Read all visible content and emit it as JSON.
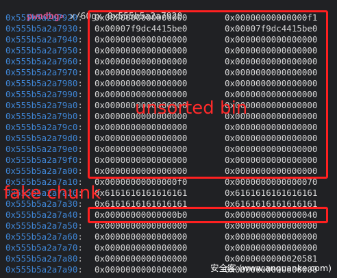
{
  "terminal": {
    "prompt": "pwndbg>",
    "command": " x/60gx 0x555b5a2a7920",
    "rows": [
      {
        "addr": "0x555b5a2a7920",
        "v1": "0x0000000000000000",
        "v2": "0x00000000000000f1"
      },
      {
        "addr": "0x555b5a2a7930",
        "v1": "0x00007f9dc4415be0",
        "v2": "0x00007f9dc4415be0"
      },
      {
        "addr": "0x555b5a2a7940",
        "v1": "0x0000000000000000",
        "v2": "0x0000000000000000"
      },
      {
        "addr": "0x555b5a2a7950",
        "v1": "0x0000000000000000",
        "v2": "0x0000000000000000"
      },
      {
        "addr": "0x555b5a2a7960",
        "v1": "0x0000000000000000",
        "v2": "0x0000000000000000"
      },
      {
        "addr": "0x555b5a2a7970",
        "v1": "0x0000000000000000",
        "v2": "0x0000000000000000"
      },
      {
        "addr": "0x555b5a2a7980",
        "v1": "0x0000000000000000",
        "v2": "0x0000000000000000"
      },
      {
        "addr": "0x555b5a2a7990",
        "v1": "0x0000000000000000",
        "v2": "0x0000000000000000"
      },
      {
        "addr": "0x555b5a2a79a0",
        "v1": "0x0000000000000000",
        "v2": "0x0000000000000000"
      },
      {
        "addr": "0x555b5a2a79b0",
        "v1": "0x0000000000000000",
        "v2": "0x0000000000000000"
      },
      {
        "addr": "0x555b5a2a79c0",
        "v1": "0x0000000000000000",
        "v2": "0x0000000000000000"
      },
      {
        "addr": "0x555b5a2a79d0",
        "v1": "0x0000000000000000",
        "v2": "0x0000000000000000"
      },
      {
        "addr": "0x555b5a2a79e0",
        "v1": "0x0000000000000000",
        "v2": "0x0000000000000000"
      },
      {
        "addr": "0x555b5a2a79f0",
        "v1": "0x0000000000000000",
        "v2": "0x0000000000000000"
      },
      {
        "addr": "0x555b5a2a7a00",
        "v1": "0x0000000000000000",
        "v2": "0x0000000000000000"
      },
      {
        "addr": "0x555b5a2a7a10",
        "v1": "0x00000000000000f0",
        "v2": "0x0000000000000070"
      },
      {
        "addr": "0x555b5a2a7a20",
        "v1": "0x6161616161616161",
        "v2": "0x6161616161616161"
      },
      {
        "addr": "0x555b5a2a7a30",
        "v1": "0x6161616161616161",
        "v2": "0x6161616161616161"
      },
      {
        "addr": "0x555b5a2a7a40",
        "v1": "0x00000000000000b0",
        "v2": "0x0000000000000040"
      },
      {
        "addr": "0x555b5a2a7a50",
        "v1": "0x0000000000000000",
        "v2": "0x0000000000000000"
      },
      {
        "addr": "0x555b5a2a7a60",
        "v1": "0x0000000000000000",
        "v2": "0x0000000000000000"
      },
      {
        "addr": "0x555b5a2a7a70",
        "v1": "0x0000000000000000",
        "v2": "0x0000000000000000"
      },
      {
        "addr": "0x555b5a2a7a80",
        "v1": "0x0000000000000000",
        "v2": "0x0000000000020581"
      },
      {
        "addr": "0x555b5a2a7a90",
        "v1": "0x0000000000000000",
        "v2": "0x0000000000000000"
      }
    ]
  },
  "annotations": {
    "unsorted_bin_label": "unsorted bin",
    "fake_chunk_label": "fake chunk",
    "color": "#ff2020"
  },
  "watermark": "安全客 (www.anquanke.com)"
}
